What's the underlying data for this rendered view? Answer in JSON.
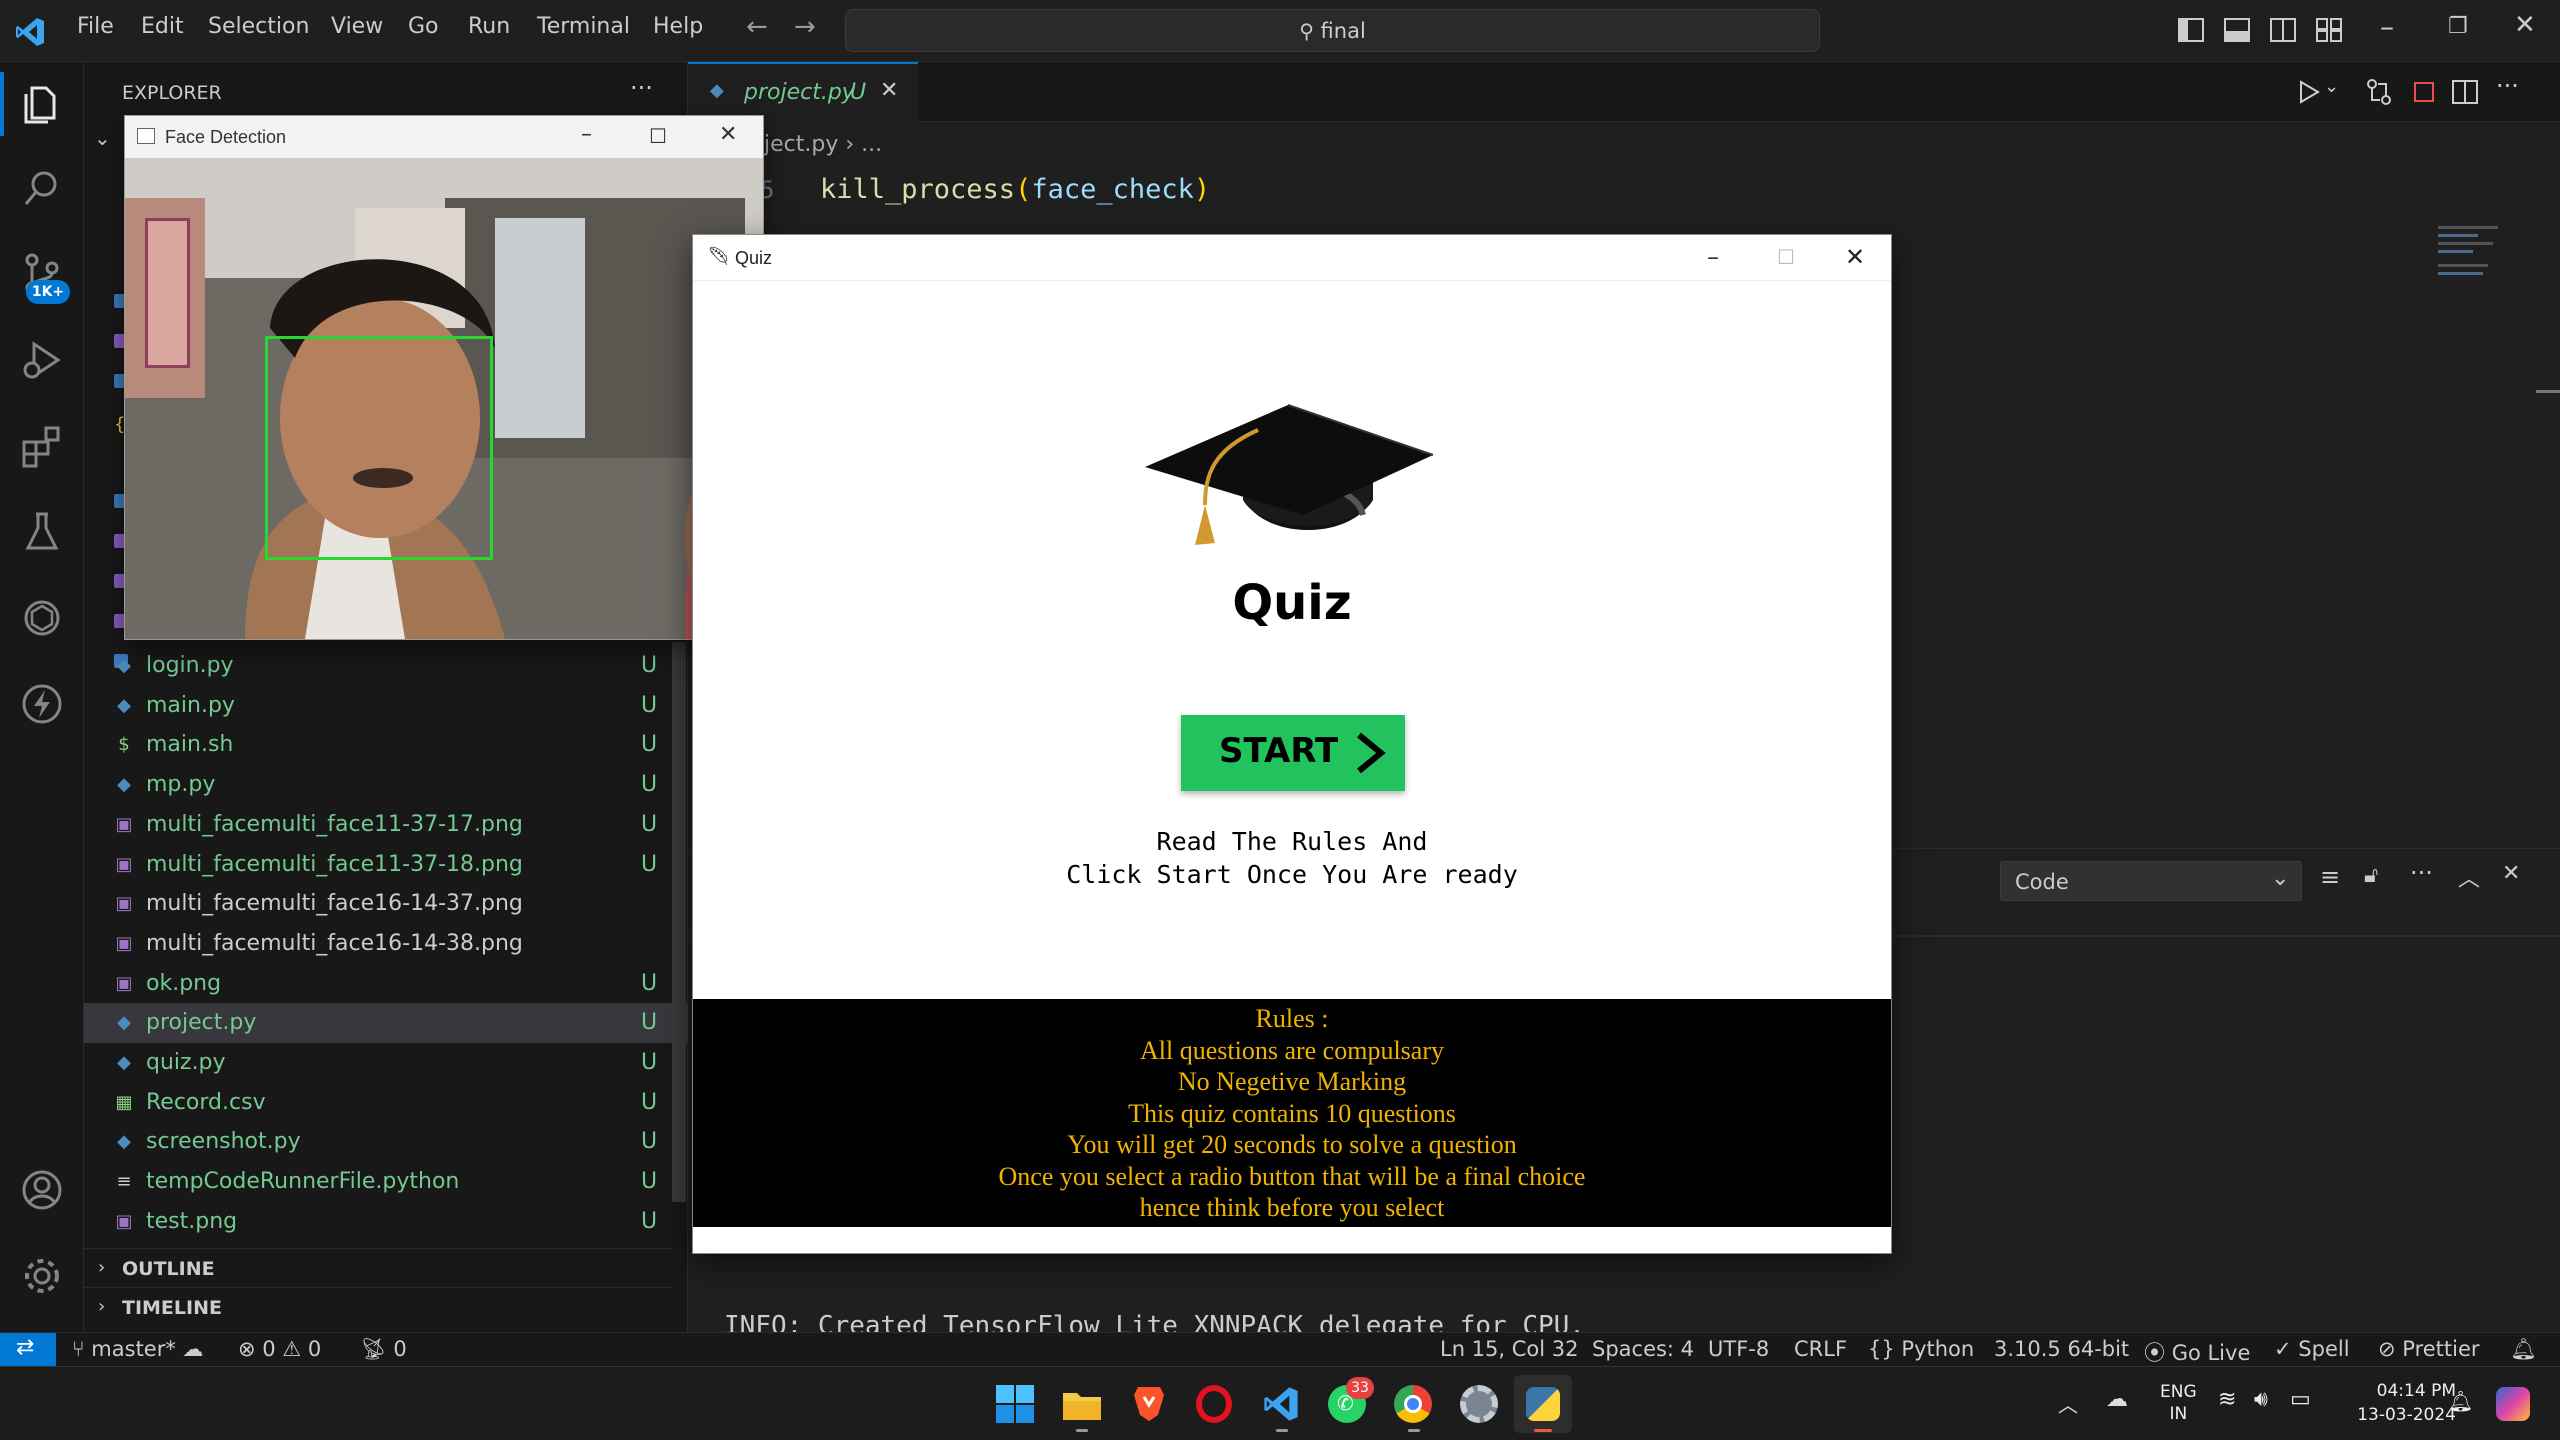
{
  "menu": [
    "File",
    "Edit",
    "Selection",
    "View",
    "Go",
    "Run",
    "Terminal",
    "Help"
  ],
  "search": {
    "text": "final"
  },
  "activity": {
    "scm_badge": "1K+"
  },
  "explorer": {
    "title": "EXPLORER",
    "files": [
      {
        "name": "login.py",
        "status": "U",
        "type": "py"
      },
      {
        "name": "main.py",
        "status": "U",
        "type": "py"
      },
      {
        "name": "main.sh",
        "status": "U",
        "type": "sh"
      },
      {
        "name": "mp.py",
        "status": "U",
        "type": "py"
      },
      {
        "name": "multi_facemulti_face11-37-17.png",
        "status": "U",
        "type": "img"
      },
      {
        "name": "multi_facemulti_face11-37-18.png",
        "status": "U",
        "type": "img"
      },
      {
        "name": "multi_facemulti_face16-14-37.png",
        "status": "",
        "type": "img"
      },
      {
        "name": "multi_facemulti_face16-14-38.png",
        "status": "",
        "type": "img"
      },
      {
        "name": "ok.png",
        "status": "U",
        "type": "img"
      },
      {
        "name": "project.py",
        "status": "U",
        "type": "py"
      },
      {
        "name": "quiz.py",
        "status": "U",
        "type": "py"
      },
      {
        "name": "Record.csv",
        "status": "U",
        "type": "csv"
      },
      {
        "name": "screenshot.py",
        "status": "U",
        "type": "py"
      },
      {
        "name": "tempCodeRunnerFile.python",
        "status": "U",
        "type": "txt"
      },
      {
        "name": "test.png",
        "status": "U",
        "type": "img"
      }
    ],
    "outline": "OUTLINE",
    "timeline": "TIMELINE"
  },
  "editor": {
    "tab": {
      "name": "project.py",
      "status": "U"
    },
    "breadcrumb": [
      "project.py",
      "..."
    ],
    "line_no": "5",
    "code": {
      "fn": "kill_process",
      "open": "(",
      "arg": "face_check",
      "close": ")"
    }
  },
  "panel": {
    "dropdown": "Code",
    "output": "INFO: Created TensorFlow Lite XNNPACK delegate for CPU."
  },
  "face_window": {
    "title": "Face Detection"
  },
  "quiz_window": {
    "title": "Quiz",
    "heading": "Quiz",
    "start_label": "START",
    "instructions": [
      "Read The Rules And",
      "Click Start Once You Are ready"
    ],
    "rules": [
      "Rules :",
      "All questions are compulsary",
      "No Negetive Marking",
      "This quiz contains 10 questions",
      "You will get 20 seconds to solve a question",
      "Once you select a radio button that will be a final choice",
      "hence think before you select"
    ],
    "colors": {
      "start": "#22c35e",
      "rules_text": "#f0b400",
      "rules_bg": "#000000"
    }
  },
  "statusbar": {
    "branch": "master*",
    "errors": "0",
    "warnings": "0",
    "ports": "0",
    "position": "Ln 15, Col 32",
    "spaces": "Spaces: 4",
    "encoding": "UTF-8",
    "eol": "CRLF",
    "language": "Python",
    "version": "3.10.5 64-bit",
    "golive": "Go Live",
    "spell": "Spell",
    "prettier": "Prettier"
  },
  "taskbar": {
    "whatsapp_badge": "33",
    "lang_top": "ENG",
    "lang_bottom": "IN",
    "time": "04:14 PM",
    "date": "13-03-2024"
  }
}
